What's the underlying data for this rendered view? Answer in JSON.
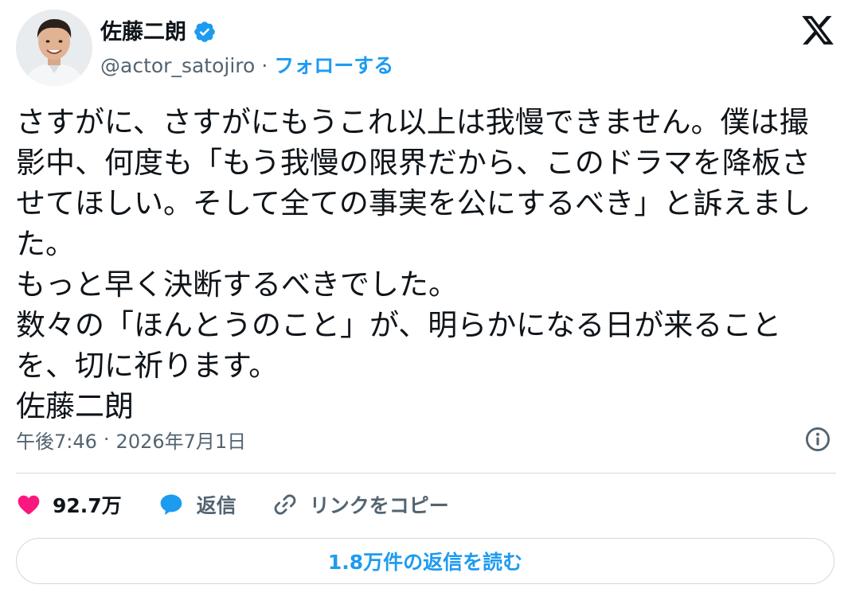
{
  "user": {
    "display_name": "佐藤二朗",
    "handle": "@actor_satojiro",
    "separator": "·",
    "follow_label": "フォローする",
    "verified": true,
    "avatar_icon": "person-avatar"
  },
  "brand": {
    "logo_icon": "x-logo-icon",
    "accent_color": "#1d9bf0"
  },
  "tweet": {
    "text": "さすがに、さすがにもうこれ以上は我慢できません。僕は撮影中、何度も「もう我慢の限界だから、このドラマを降板させてほしい。そして全ての事実を公にするべき」と訴えました。\nもっと早く決断するべきでした。\n数々の「ほんとうのこと」が、明らかになる日が来ることを、切に祈ります。\n佐藤二朗"
  },
  "meta": {
    "time": "午後7:46",
    "separator": "·",
    "date": "2026年7月1日",
    "info_icon": "info-icon"
  },
  "actions": {
    "like_count": "92.7万",
    "like_color": "#f91880",
    "reply_label": "返信",
    "copy_link_label": "リンクをコピー"
  },
  "read_replies": {
    "label": "1.8万件の返信を読む"
  }
}
